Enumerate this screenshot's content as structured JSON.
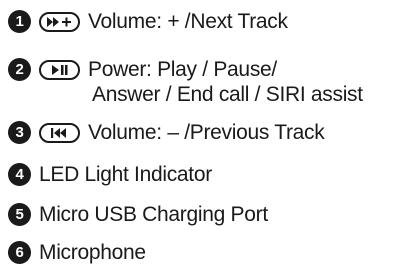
{
  "items": [
    {
      "number": "1",
      "icon": "next-track-plus-icon",
      "text": "Volume: + /Next Track"
    },
    {
      "number": "2",
      "icon": "play-pause-icon",
      "text": "Power: Play / Pause/",
      "text_line2": "Answer / End call / SIRI assist"
    },
    {
      "number": "3",
      "icon": "previous-track-icon",
      "text": "Volume: – /Previous Track"
    },
    {
      "number": "4",
      "text": "LED Light Indicator"
    },
    {
      "number": "5",
      "text": "Micro USB Charging Port"
    },
    {
      "number": "6",
      "text": "Microphone"
    }
  ],
  "colors": {
    "text": "#1a1a1a",
    "background": "#ffffff"
  }
}
